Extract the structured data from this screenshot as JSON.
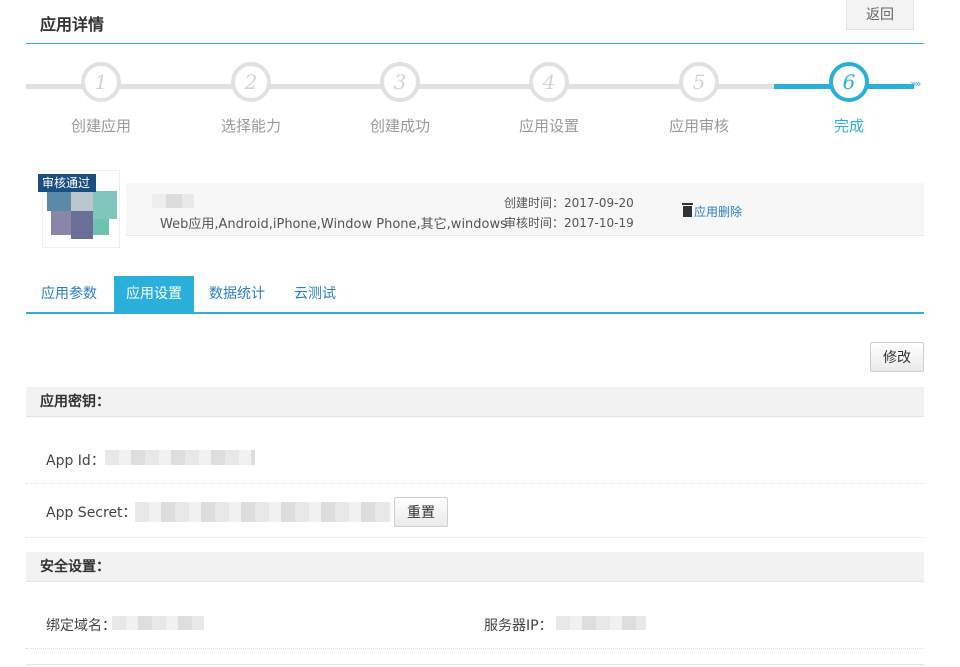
{
  "header": {
    "title": "应用详情",
    "back_label": "返回"
  },
  "steps": [
    {
      "number": "1",
      "label": "创建应用"
    },
    {
      "number": "2",
      "label": "选择能力"
    },
    {
      "number": "3",
      "label": "创建成功"
    },
    {
      "number": "4",
      "label": "应用设置"
    },
    {
      "number": "5",
      "label": "应用审核"
    },
    {
      "number": "6",
      "label": "完成"
    }
  ],
  "active_step": 6,
  "app": {
    "badge": "审核通过",
    "platforms": "Web应用,Android,iPhone,Window Phone,其它,windows",
    "created": "创建时间：2017-09-20",
    "reviewed": "审核时间：2017-10-19",
    "delete_label": "应用删除"
  },
  "tabs": [
    {
      "label": "应用参数"
    },
    {
      "label": "应用设置"
    },
    {
      "label": "数据统计"
    },
    {
      "label": "云测试"
    }
  ],
  "active_tab": "应用设置",
  "edit_label": "修改",
  "keys_section": {
    "title": "应用密钥：",
    "app_id_label": "App Id：",
    "app_secret_label": "App Secret：",
    "reset_label": "重置"
  },
  "security_section": {
    "title": "安全设置：",
    "domain_label": "绑定域名：",
    "server_ip_label": "服务器IP："
  },
  "colors": {
    "accent": "#2bb0dc",
    "link": "#2a7fbf",
    "track": "#e1e1e1"
  }
}
